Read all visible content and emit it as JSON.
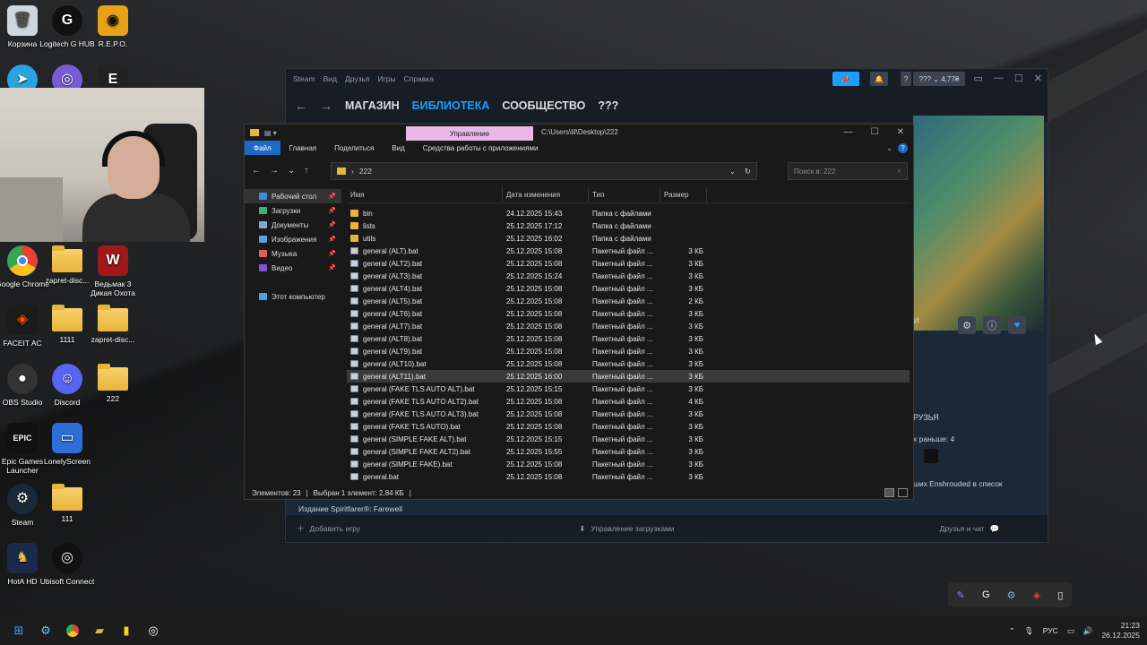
{
  "desktop": {
    "icons": [
      {
        "label": "Корзина"
      },
      {
        "label": "Logitech G HUB"
      },
      {
        "label": "R.E.P.O."
      },
      {
        "label": "Google Chrome"
      },
      {
        "label": "zapret-disc..."
      },
      {
        "label": "Ведьмак 3 Дикая Охота"
      },
      {
        "label": "FACEIT AC"
      },
      {
        "label": "1111"
      },
      {
        "label": "zapret-disc..."
      },
      {
        "label": "OBS Studio"
      },
      {
        "label": "Discord"
      },
      {
        "label": "222"
      },
      {
        "label": "Epic Games Launcher"
      },
      {
        "label": "LonelyScreen"
      },
      {
        "label": "Steam"
      },
      {
        "label": "111"
      },
      {
        "label": "HotA HD"
      },
      {
        "label": "Ubisoft Connect"
      }
    ]
  },
  "steam": {
    "menu": [
      "Steam",
      "Вид",
      "Друзья",
      "Игры",
      "Справка"
    ],
    "tabs": [
      "МАГАЗИН",
      "БИБЛИОТЕКА",
      "СООБЩЕСТВО",
      "???"
    ],
    "active_tab": "БИБЛИОТЕКА",
    "account": "??? ⌄ 4,77₴",
    "help": "?",
    "right_truncated": "И",
    "friends_heading": "РУЗЬЯ",
    "friends_earlier": "х раньше: 4",
    "wishlist_text": "ших Enshrouded в список",
    "spirit_item": "Издание Spiritfarer®: Farewell",
    "add_game": "Добавить игру",
    "downloads": "Управление загрузками",
    "friends_chat": "Друзья и чат"
  },
  "explorer": {
    "manage_tab": "Управление",
    "path": "C:\\Users\\lil\\Desktop\\222",
    "ribbon": [
      "Файл",
      "Главная",
      "Поделиться",
      "Вид",
      "Средства работы с приложениями"
    ],
    "breadcrumb": "222",
    "search_placeholder": "Поиск в: 222",
    "sidebar": [
      {
        "label": "Рабочий стол",
        "color": "#3b8fe0",
        "pinned": true,
        "selected": true
      },
      {
        "label": "Загрузки",
        "color": "#3bb26b",
        "pinned": true
      },
      {
        "label": "Документы",
        "color": "#7fa8d8",
        "pinned": true
      },
      {
        "label": "Изображения",
        "color": "#5aa0e6",
        "pinned": true
      },
      {
        "label": "Музыка",
        "color": "#e0604d",
        "pinned": true
      },
      {
        "label": "Видео",
        "color": "#8a4fd8",
        "pinned": true
      },
      {
        "label": "Этот компьютер",
        "color": "#4aa3e8",
        "pinned": false
      }
    ],
    "columns": [
      "Имя",
      "Дата изменения",
      "Тип",
      "Размер"
    ],
    "files": [
      {
        "name": "bin",
        "date": "24.12.2025 15:43",
        "type": "Папка с файлами",
        "size": "",
        "folder": true
      },
      {
        "name": "lists",
        "date": "25.12.2025 17:12",
        "type": "Папка с файлами",
        "size": "",
        "folder": true
      },
      {
        "name": "utils",
        "date": "25.12.2025 16:02",
        "type": "Папка с файлами",
        "size": "",
        "folder": true
      },
      {
        "name": "general (ALT).bat",
        "date": "25.12.2025 15:08",
        "type": "Пакетный файл ...",
        "size": "3 КБ"
      },
      {
        "name": "general (ALT2).bat",
        "date": "25.12.2025 15:08",
        "type": "Пакетный файл ...",
        "size": "3 КБ"
      },
      {
        "name": "general (ALT3).bat",
        "date": "25.12.2025 15:24",
        "type": "Пакетный файл ...",
        "size": "3 КБ"
      },
      {
        "name": "general (ALT4).bat",
        "date": "25.12.2025 15:08",
        "type": "Пакетный файл ...",
        "size": "3 КБ"
      },
      {
        "name": "general (ALT5).bat",
        "date": "25.12.2025 15:08",
        "type": "Пакетный файл ...",
        "size": "2 КБ"
      },
      {
        "name": "general (ALT6).bat",
        "date": "25.12.2025 15:08",
        "type": "Пакетный файл ...",
        "size": "3 КБ"
      },
      {
        "name": "general (ALT7).bat",
        "date": "25.12.2025 15:08",
        "type": "Пакетный файл ...",
        "size": "3 КБ"
      },
      {
        "name": "general (ALT8).bat",
        "date": "25.12.2025 15:08",
        "type": "Пакетный файл ...",
        "size": "3 КБ"
      },
      {
        "name": "general (ALT9).bat",
        "date": "25.12.2025 15:08",
        "type": "Пакетный файл ...",
        "size": "3 КБ"
      },
      {
        "name": "general (ALT10).bat",
        "date": "25.12.2025 15:08",
        "type": "Пакетный файл ...",
        "size": "3 КБ"
      },
      {
        "name": "general (ALT11).bat",
        "date": "25.12.2025 16:00",
        "type": "Пакетный файл ...",
        "size": "3 КБ",
        "selected": true
      },
      {
        "name": "general (FAKE TLS AUTO ALT).bat",
        "date": "25.12.2025 15:15",
        "type": "Пакетный файл ...",
        "size": "3 КБ"
      },
      {
        "name": "general (FAKE TLS AUTO ALT2).bat",
        "date": "25.12.2025 15:08",
        "type": "Пакетный файл ...",
        "size": "4 КБ"
      },
      {
        "name": "general (FAKE TLS AUTO ALT3).bat",
        "date": "25.12.2025 15:08",
        "type": "Пакетный файл ...",
        "size": "3 КБ"
      },
      {
        "name": "general (FAKE TLS AUTO).bat",
        "date": "25.12.2025 15:08",
        "type": "Пакетный файл ...",
        "size": "3 КБ"
      },
      {
        "name": "general (SIMPLE FAKE ALT).bat",
        "date": "25.12.2025 15:15",
        "type": "Пакетный файл ...",
        "size": "3 КБ"
      },
      {
        "name": "general (SIMPLE FAKE ALT2).bat",
        "date": "25.12.2025 15:55",
        "type": "Пакетный файл ...",
        "size": "3 КБ"
      },
      {
        "name": "general (SIMPLE FAKE).bat",
        "date": "25.12.2025 15:08",
        "type": "Пакетный файл ...",
        "size": "3 КБ"
      },
      {
        "name": "general.bat",
        "date": "25.12.2025 15:08",
        "type": "Пакетный файл ...",
        "size": "3 КБ"
      }
    ],
    "status_count": "Элементов: 23",
    "status_selected": "Выбран 1 элемент: 2,84 КБ"
  },
  "taskbar": {
    "language": "РУС",
    "time": "21:23",
    "date": "26.12.2025"
  }
}
